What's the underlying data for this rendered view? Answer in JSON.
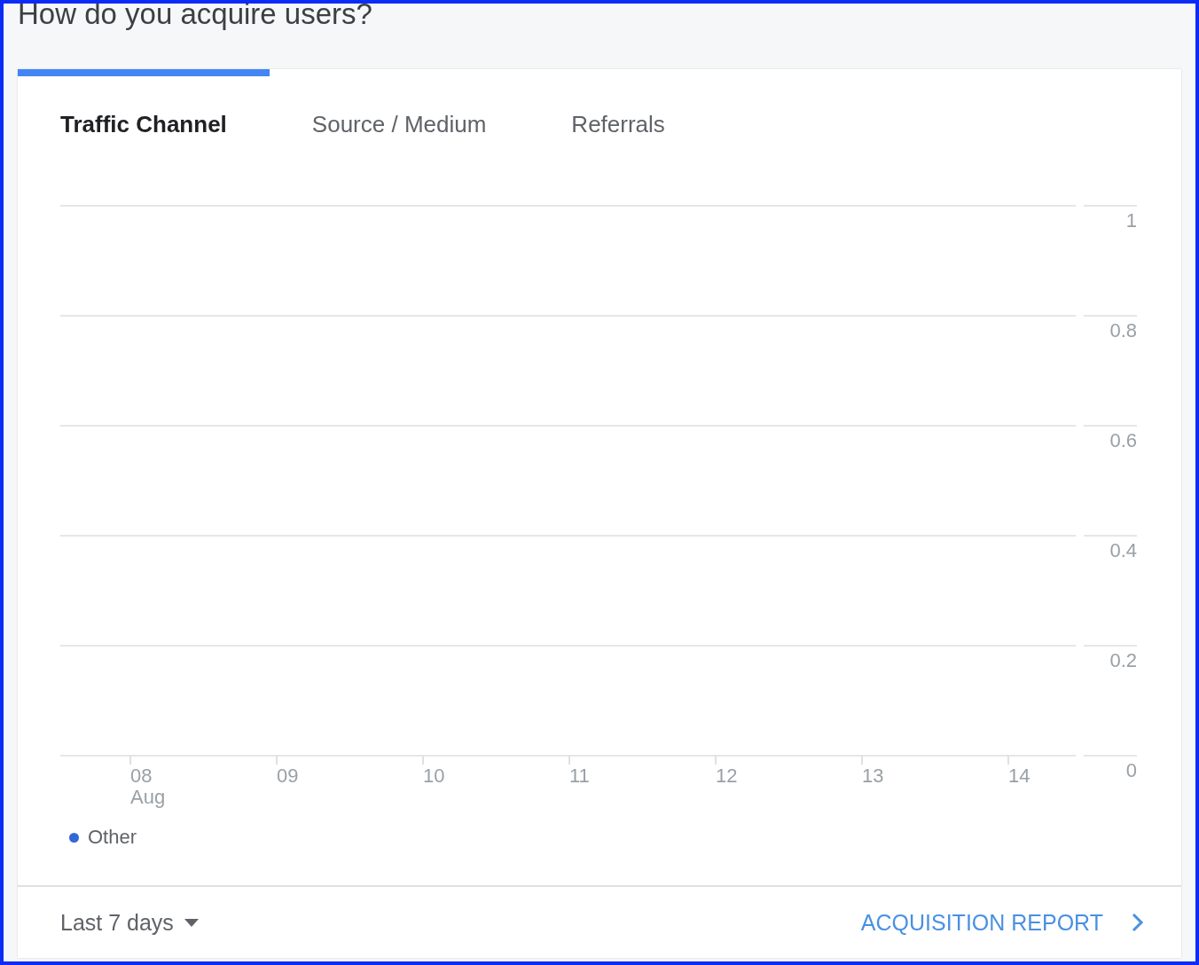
{
  "title": "How do you acquire users?",
  "tabs": [
    {
      "label": "Traffic Channel",
      "selected": true
    },
    {
      "label": "Source / Medium",
      "selected": false
    },
    {
      "label": "Referrals",
      "selected": false
    }
  ],
  "chart": {
    "chart_data": {
      "type": "line",
      "categories": [
        "08 Aug",
        "09",
        "10",
        "11",
        "12",
        "13",
        "14"
      ],
      "series": [
        {
          "name": "Other",
          "color": "#3367d6",
          "values": [
            null,
            null,
            null,
            null,
            null,
            null,
            null
          ]
        }
      ],
      "ylim": [
        0,
        1
      ],
      "grid": true,
      "yticks": [
        0,
        0.2,
        0.4,
        0.6,
        0.8,
        1
      ]
    }
  },
  "footer": {
    "range": "Last 7 days",
    "link": "ACQUISITION REPORT"
  }
}
